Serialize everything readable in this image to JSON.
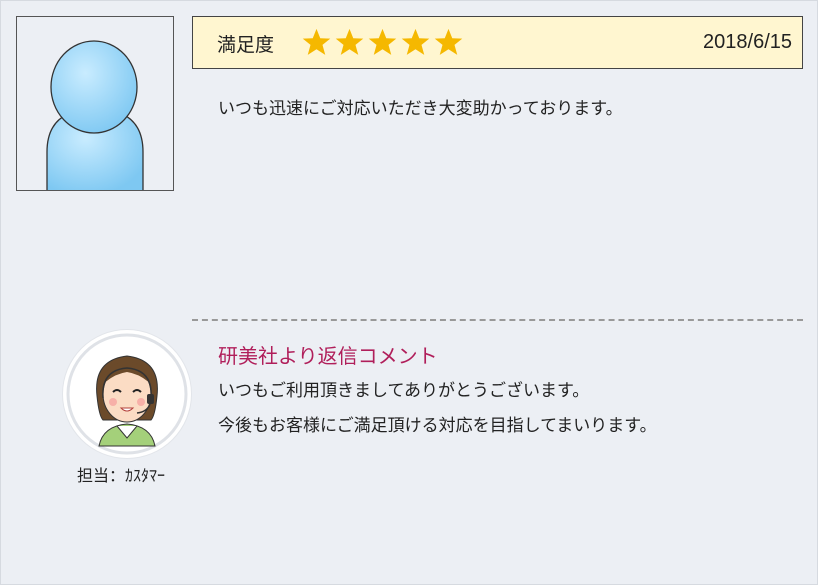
{
  "review": {
    "rating_label": "満足度",
    "stars": 5,
    "date": "2018/6/15",
    "text": "いつも迅速にご対応いただき大変助かっております。"
  },
  "reply": {
    "title": "研美社より返信コメント",
    "lines": [
      "いつもご利用頂きましてありがとうございます。",
      "今後もお客様にご満足頂ける対応を目指してまいります。"
    ],
    "staff_label": "担当：ｶｽﾀﾏｰ"
  },
  "colors": {
    "background": "#eceff4",
    "rating_bar": "#fff6d0",
    "star": "#f5b800",
    "reply_title": "#b01e5a",
    "avatar_blue": "#8cd0f5"
  },
  "icons": {
    "user_avatar": "user-silhouette-icon",
    "star": "star-icon",
    "staff_avatar": "staff-portrait-icon"
  }
}
